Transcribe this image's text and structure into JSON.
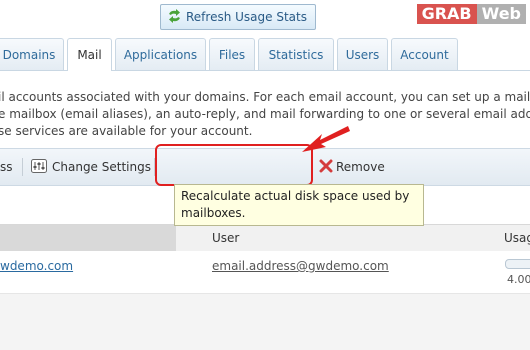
{
  "logo": {
    "part1": "GRAB",
    "part2": "Web"
  },
  "tabs": [
    {
      "label": "Domains"
    },
    {
      "label": "Mail"
    },
    {
      "label": "Applications"
    },
    {
      "label": "Files"
    },
    {
      "label": "Statistics"
    },
    {
      "label": "Users"
    },
    {
      "label": "Account"
    }
  ],
  "description": {
    "line1": "il accounts associated with your domains. For each email account, you can set up a mailbo",
    "line2": "e mailbox (email aliases), an auto-reply, and mail forwarding to one or several email addre",
    "line3": "se services are available for your account."
  },
  "toolbar": {
    "partial_label": "ss",
    "change_settings": "Change Settings",
    "refresh": "Refresh Usage Stats",
    "remove": "Remove"
  },
  "tooltip": {
    "text_line1": "Recalculate actual disk space used by",
    "text_line2": "mailboxes."
  },
  "table": {
    "headers": {
      "user": "User",
      "usage": "Usag"
    },
    "rows": [
      {
        "domain": "wdemo.com",
        "user": "email.address@gwdemo.com",
        "usage": "4.00"
      }
    ]
  },
  "colors": {
    "highlight": "#e02020",
    "accent": "#2f6b9b"
  }
}
